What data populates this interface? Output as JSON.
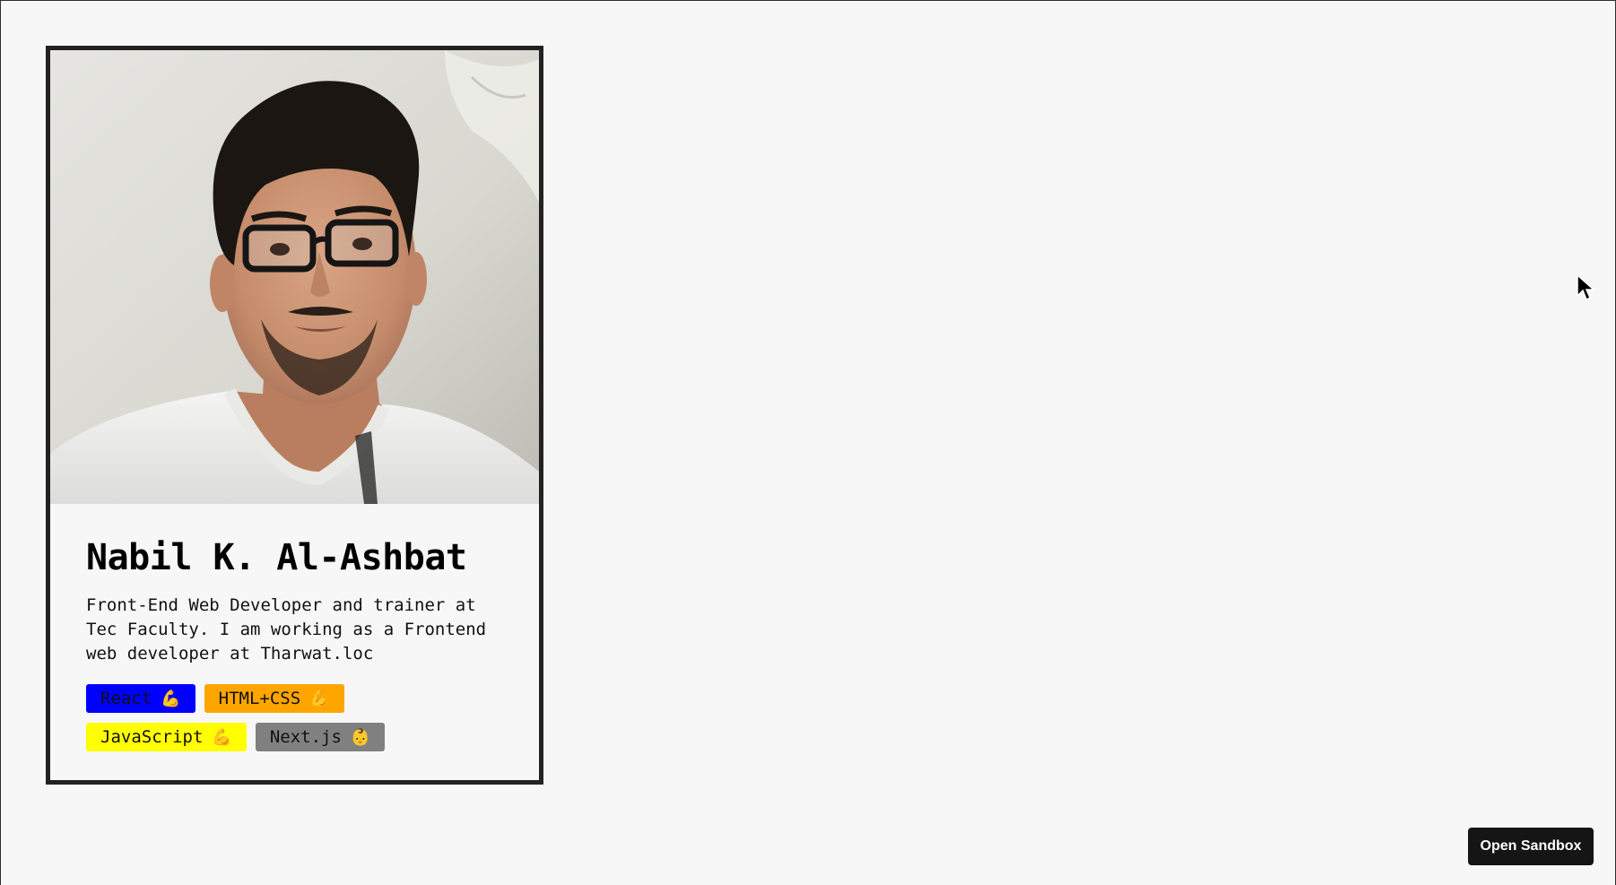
{
  "profile": {
    "photo_alt": "Nabil K. Al-Ashbat",
    "name": "Nabil K. Al-Ashbat",
    "bio": "Front-End Web Developer and trainer at Tec Faculty. I am working as a Frontend web developer at Tharwat.loc"
  },
  "skills": [
    {
      "label": "React",
      "emoji": "💪",
      "color": "#0000ff"
    },
    {
      "label": "HTML+CSS",
      "emoji": "💪",
      "color": "#ffa500"
    },
    {
      "label": "JavaScript",
      "emoji": "💪",
      "color": "#ffff00"
    },
    {
      "label": "Next.js",
      "emoji": "👶",
      "color": "#808080"
    }
  ],
  "sandbox": {
    "open_label": "Open Sandbox"
  }
}
